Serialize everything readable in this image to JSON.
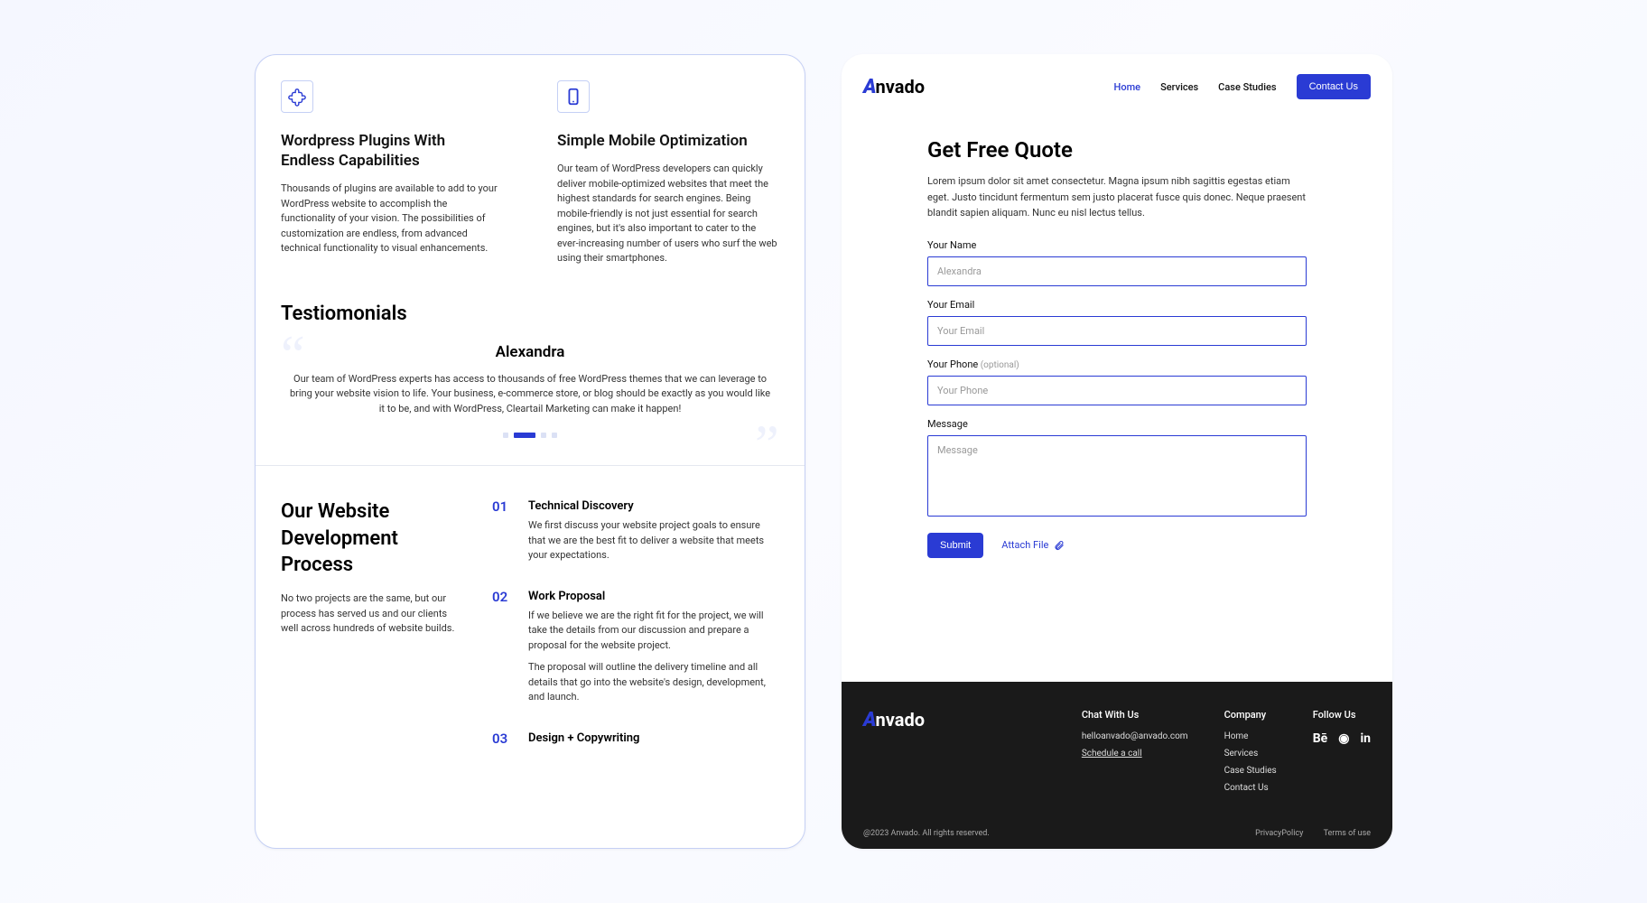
{
  "features": [
    {
      "title": "Wordpress Plugins With Endless Capabilities",
      "body": "Thousands of plugins are available to add to your WordPress website to accomplish the functionality of your vision. The possibilities of customization are endless, from advanced technical functionality to visual enhancements."
    },
    {
      "title": "Simple Mobile Optimization",
      "body": "Our team of WordPress developers can quickly deliver mobile-optimized websites that meet the highest standards for search engines. Being mobile-friendly is not just essential for search engines, but it's also important to cater to the ever-increasing number of users who surf the web using their smartphones."
    }
  ],
  "testimonials": {
    "heading": "Testiomonials",
    "name": "Alexandra",
    "text": "Our team of WordPress experts has access to thousands of free WordPress themes that we can leverage to bring your website vision to life. Your business, e-commerce store, or blog should be exactly as you would like it to be, and with WordPress, Cleartail Marketing can make it happen!"
  },
  "process": {
    "heading": "Our Website Development Process",
    "sub": "No two projects are the same, but our process has served us and our clients well across hundreds of website builds.",
    "steps": [
      {
        "num": "01",
        "title": "Technical Discovery",
        "paras": [
          "We first discuss your website project goals to ensure that we are the best fit to deliver a website that meets your expectations."
        ]
      },
      {
        "num": "02",
        "title": "Work Proposal",
        "paras": [
          "If we believe we are the right fit for the project, we will take the details from our discussion and prepare a proposal for the website project.",
          "The proposal will outline the delivery timeline and all details that go into the website's design, development, and launch."
        ]
      },
      {
        "num": "03",
        "title": "Design + Copywriting",
        "paras": []
      }
    ]
  },
  "brand": "nvado",
  "nav": {
    "home": "Home",
    "services": "Services",
    "cases": "Case Studies",
    "contact": "Contact Us"
  },
  "quote": {
    "heading": "Get Free Quote",
    "intro": "Lorem ipsum dolor sit amet consectetur. Magna ipsum nibh sagittis egestas etiam eget. Justo tincidunt fermentum sem justo placerat fusce quis donec. Neque praesent blandit sapien aliquam. Nunc eu nisl lectus tellus.",
    "name_label": "Your Name",
    "name_ph": "Alexandra",
    "email_label": "Your Email",
    "email_ph": "Your Email",
    "phone_label": "Your Phone",
    "phone_opt": " (optional)",
    "phone_ph": "Your Phone",
    "msg_label": "Message",
    "msg_ph": "Message",
    "submit": "Submit",
    "attach": "Attach File"
  },
  "footer": {
    "chat_h": "Chat With Us",
    "email": "helloanvado@anvado.com",
    "call": "Schedule a call",
    "company_h": "Company",
    "links": {
      "home": "Home",
      "services": "Services",
      "cases": "Case Studies",
      "contact": "Contact Us"
    },
    "follow_h": "Follow Us",
    "copyright": "@2023 Anvado. All rights reserved.",
    "privacy": "PrivacyPolicy",
    "terms": "Terms of use"
  }
}
